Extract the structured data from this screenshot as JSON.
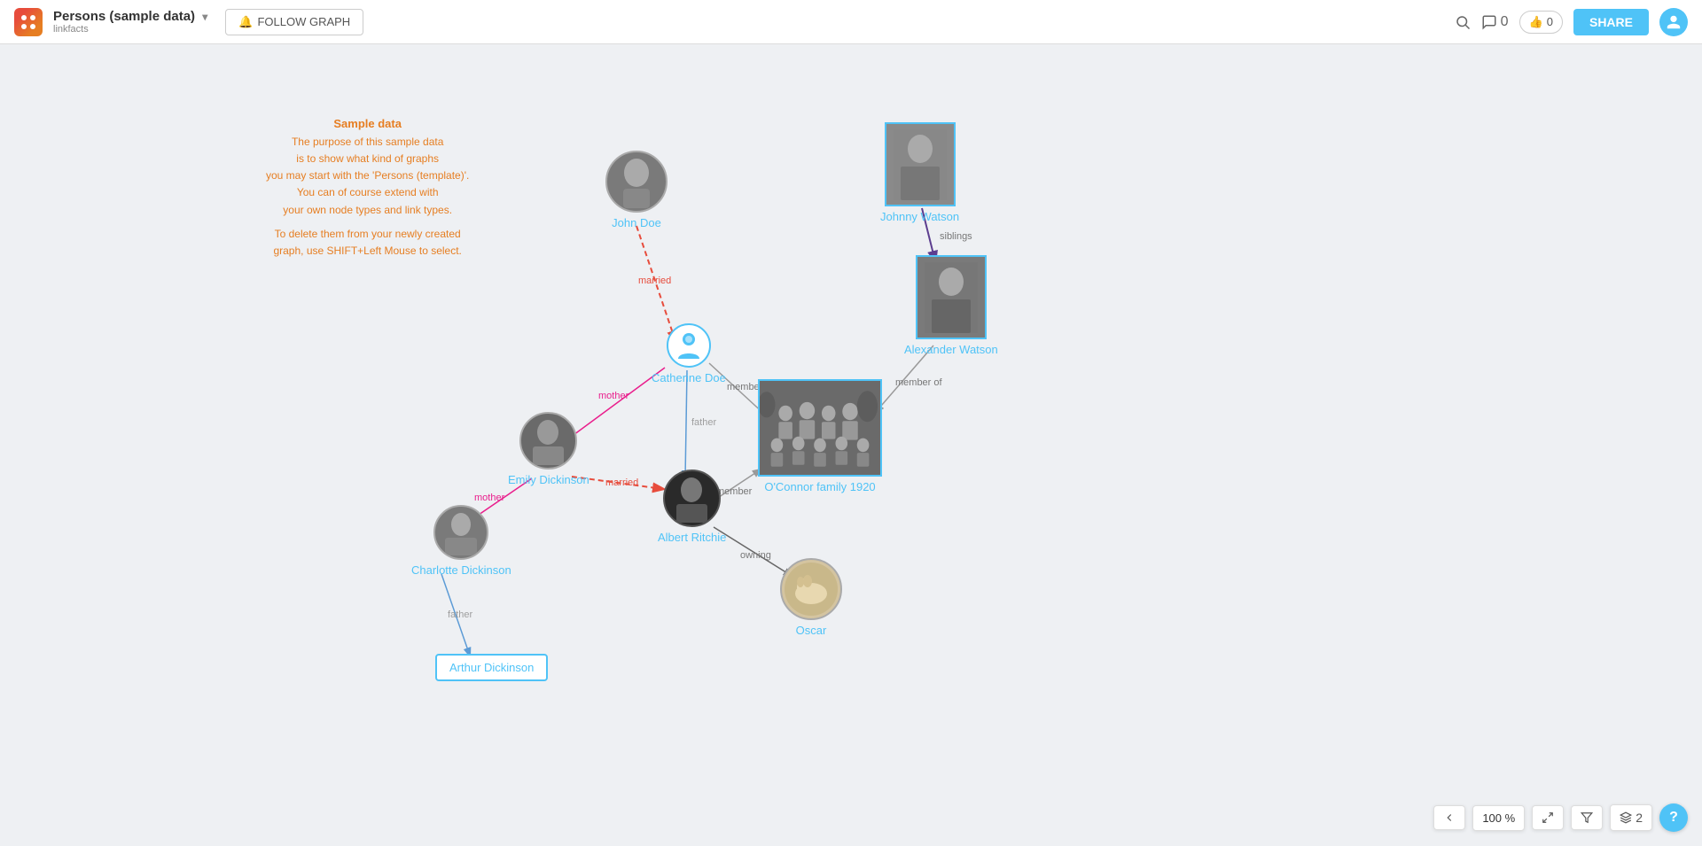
{
  "navbar": {
    "title": "Persons (sample data)",
    "subtitle": "linkfacts",
    "follow_label": "FOLLOW GRAPH",
    "comments_count": "0",
    "likes_count": "0",
    "share_label": "SHARE"
  },
  "sample_note": {
    "title": "Sample data",
    "line1": "The purpose of this sample data",
    "line2": "is to show what kind of graphs",
    "line3": "you may start with the 'Persons (template)'.",
    "line4": "You can of course extend with",
    "line5": "your own node types and link types.",
    "line6": "",
    "line7": "To delete them from your newly created",
    "line8": "graph, use SHIFT+Left Mouse to select."
  },
  "nodes": {
    "john_doe": {
      "label": "John Doe"
    },
    "catherine_doe": {
      "label": "Catherine Doe"
    },
    "johnny_watson": {
      "label": "Johnny Watson"
    },
    "alexander_watson": {
      "label": "Alexander Watson"
    },
    "emily_dickinson": {
      "label": "Emily Dickinson"
    },
    "charlotte_dickinson": {
      "label": "Charlotte Dickinson"
    },
    "albert_ritchie": {
      "label": "Albert Ritchie"
    },
    "arthur_dickinson": {
      "label": "Arthur Dickinson"
    },
    "oconnor_family": {
      "label": "O'Connor family 1920"
    },
    "oscar": {
      "label": "Oscar"
    }
  },
  "edge_labels": {
    "married1": "married",
    "married2": "married",
    "mother1": "mother",
    "mother2": "mother",
    "father1": "father",
    "father2": "father",
    "siblings": "siblings",
    "member1": "member of",
    "member2": "member of",
    "member3": "member of",
    "owning": "owning"
  },
  "toolbar": {
    "zoom": "100 %",
    "layers": "2",
    "help": "?"
  }
}
